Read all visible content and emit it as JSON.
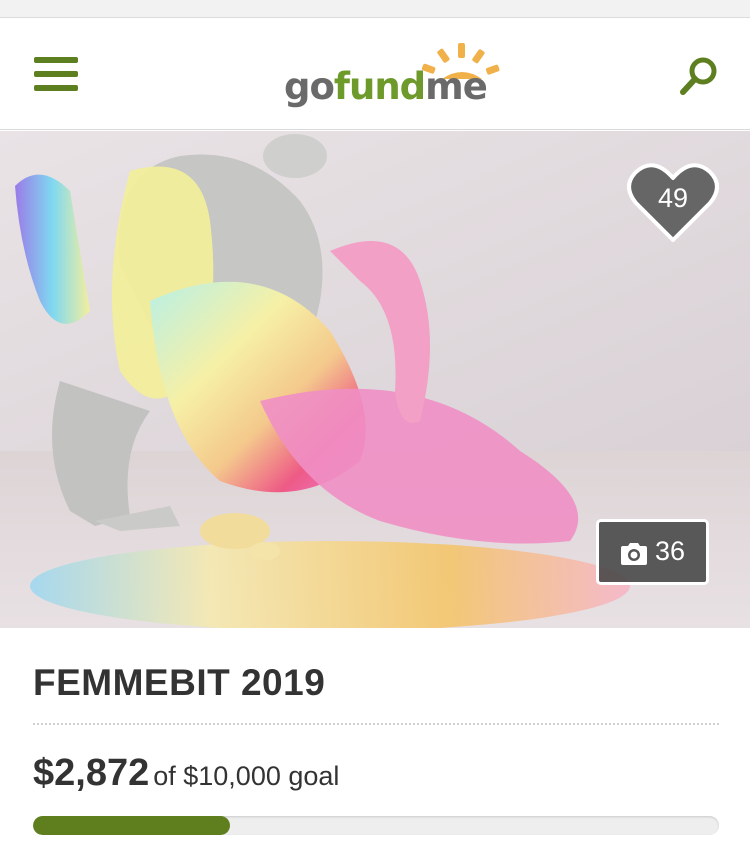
{
  "header": {
    "menu_icon": "hamburger-menu-icon",
    "logo": {
      "part1": "go",
      "part2": "fund",
      "part3": "me"
    },
    "search_icon": "search-icon",
    "brand_green": "#5d7f1f"
  },
  "hero": {
    "image_icon": "campaign-photo",
    "hearts": {
      "icon": "heart-icon",
      "count": "49"
    },
    "photos": {
      "icon": "camera-icon",
      "count": "36"
    }
  },
  "campaign": {
    "title": "FEMMEBIT 2019",
    "raised": "$2,872",
    "goal_text": "of $10,000 goal",
    "progress_fraction": 0.2872,
    "progress_color": "#5f7f1f"
  }
}
